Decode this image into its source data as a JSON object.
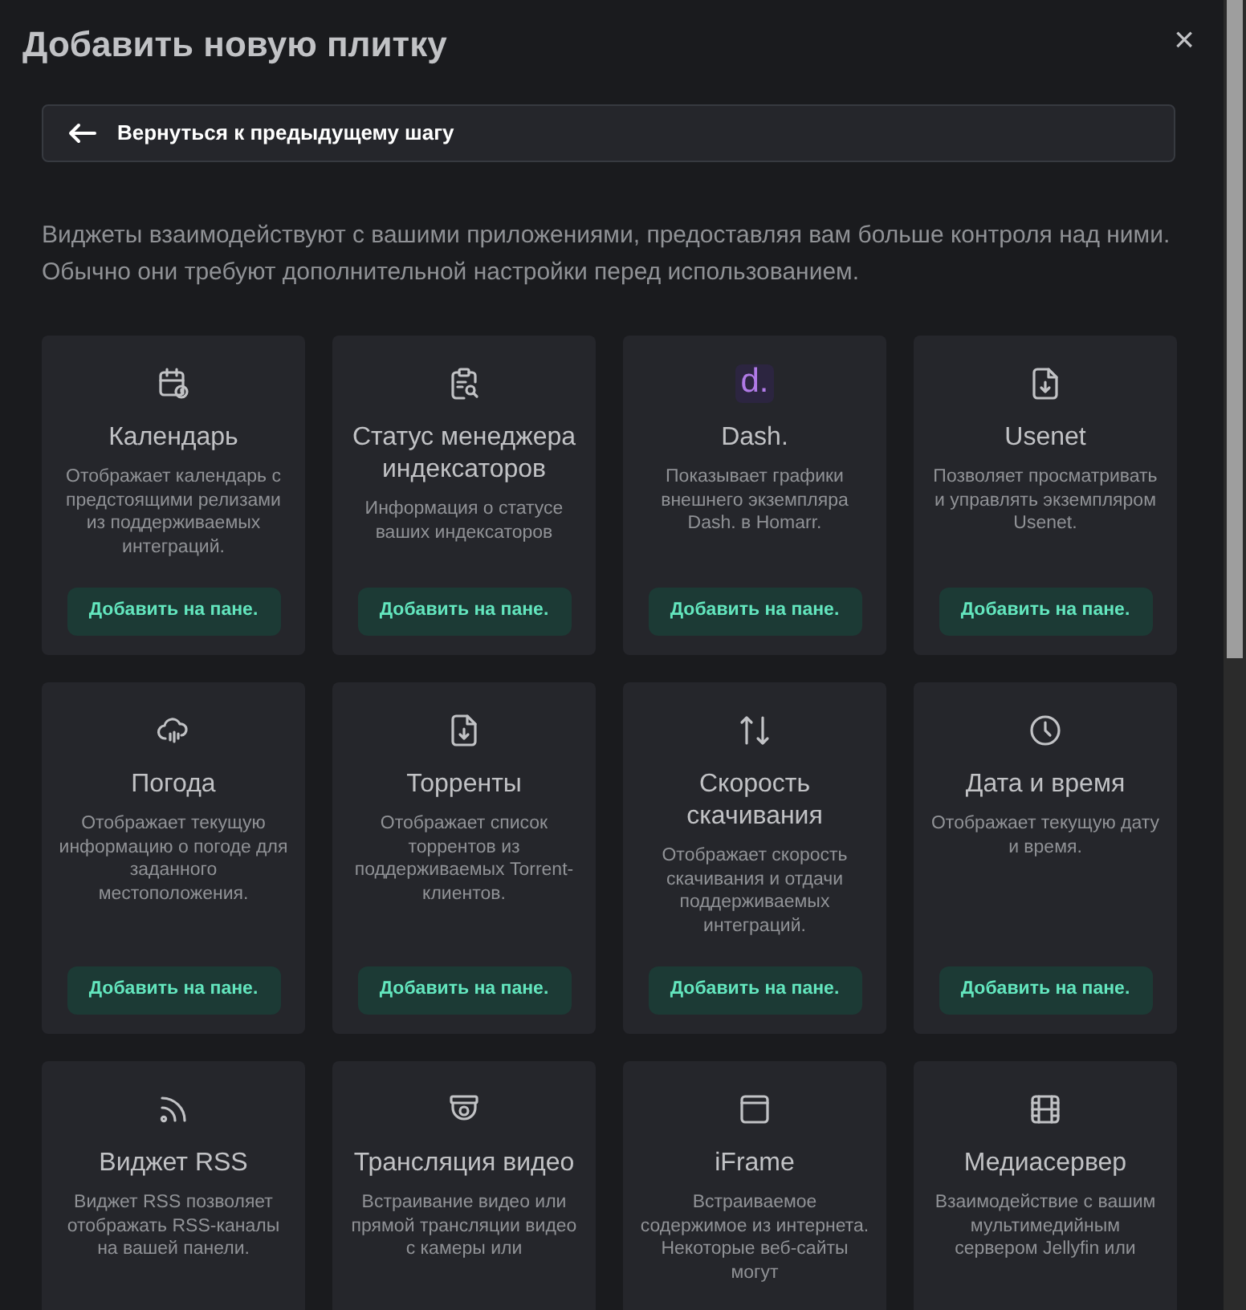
{
  "title": "Добавить новую плитку",
  "close": "×",
  "back_button": "Вернуться к предыдущему шагу",
  "intro": "Виджеты взаимодействуют с вашими приложениями, предоставляя вам больше контроля над ними. Обычно они требуют дополнительной настройки перед использованием.",
  "widgets": [
    {
      "kind": "calendar",
      "title": "Календарь",
      "description": "Отображает календарь с предстоящими релизами из поддерживаемых интеграций.",
      "button": "Добавить на пане."
    },
    {
      "kind": "clipboard-search",
      "title": "Статус менеджера индексаторов",
      "description": "Информация о статусе ваших индексаторов",
      "button": "Добавить на пане."
    },
    {
      "kind": "logo",
      "logo_text": "d.",
      "title": "Dash.",
      "description": "Показывает графики внешнего экземпляра Dash. в Homarr.",
      "button": "Добавить на пане."
    },
    {
      "kind": "file-download",
      "title": "Usenet",
      "description": "Позволяет просматривать и управлять экземпляром Usenet.",
      "button": "Добавить на пане."
    },
    {
      "kind": "cloud",
      "title": "Погода",
      "description": "Отображает текущую информацию о погоде для заданного местоположения.",
      "button": "Добавить на пане."
    },
    {
      "kind": "file-download",
      "title": "Торренты",
      "description": "Отображает список торрентов из поддерживаемых Torrent-клиентов.",
      "button": "Добавить на пане."
    },
    {
      "kind": "arrows",
      "title": "Скорость скачивания",
      "description": "Отображает скорость скачивания и отдачи поддерживаемых интеграций.",
      "button": "Добавить на пане."
    },
    {
      "kind": "clock",
      "title": "Дата и время",
      "description": "Отображает текущую дату и время.",
      "button": "Добавить на пане."
    },
    {
      "kind": "rss",
      "title": "Виджет RSS",
      "description": "Виджет RSS позволяет отображать RSS-каналы на вашей панели."
    },
    {
      "kind": "camera",
      "title": "Трансляция видео",
      "description": "Встраивание видео или прямой трансляции видео с камеры или"
    },
    {
      "kind": "browser",
      "title": "iFrame",
      "description": "Встраиваемое содержимое из интернета. Некоторые веб-сайты могут"
    },
    {
      "kind": "film",
      "title": "Медиасервер",
      "description": "Взаимодействие с вашим мультимедийным сервером Jellyfin или"
    }
  ]
}
